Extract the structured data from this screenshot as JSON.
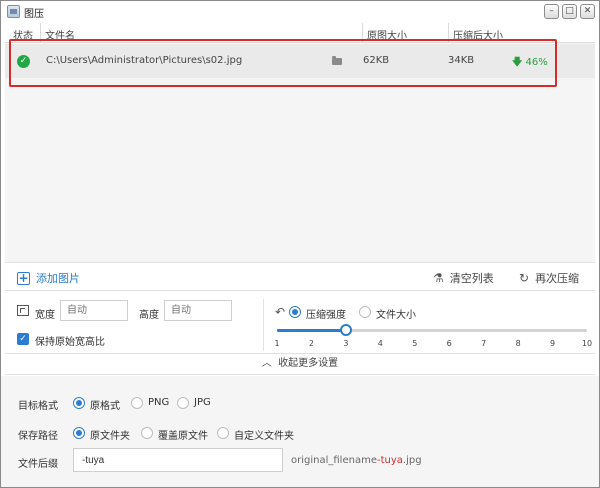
{
  "window": {
    "title": "图压",
    "min_icon": "minimize-icon",
    "max_icon": "maximize-icon",
    "close_icon": "close-icon"
  },
  "table": {
    "headers": [
      "状态",
      "文件名",
      "原图大小",
      "压缩后大小"
    ],
    "rows": [
      {
        "status": "success",
        "filename": "C:\\Users\\Administrator\\Pictures\\s02.jpg",
        "original_size": "62KB",
        "compressed_size": "34KB",
        "reduction": "46%"
      }
    ]
  },
  "toolbar": {
    "add_label": "添加图片",
    "clear_label": "清空列表",
    "recompress_label": "再次压缩"
  },
  "size_settings": {
    "width_label": "宽度",
    "width_placeholder": "自动",
    "height_label": "高度",
    "height_placeholder": "自动",
    "keep_ratio_label": "保持原始宽高比",
    "keep_ratio_checked": true
  },
  "compress_mode": {
    "options": [
      "压缩强度",
      "文件大小"
    ],
    "selected": "压缩强度",
    "slider": {
      "min": 1,
      "max": 10,
      "value": 3,
      "ticks": [
        "1",
        "2",
        "3",
        "4",
        "5",
        "6",
        "7",
        "8",
        "9",
        "10"
      ]
    }
  },
  "collapse_label": "收起更多设置",
  "format": {
    "label": "目标格式",
    "options": [
      "原格式",
      "PNG",
      "JPG"
    ],
    "selected": "原格式"
  },
  "save_path": {
    "label": "保存路径",
    "options": [
      "原文件夹",
      "覆盖原文件",
      "自定义文件夹"
    ],
    "selected": "原文件夹"
  },
  "suffix": {
    "label": "文件后缀",
    "value": "-tuya",
    "example_prefix": "original_filename",
    "example_suffix": "-tuya",
    "example_ext": ".jpg"
  },
  "colors": {
    "accent": "#2b7cd3",
    "success": "#22a745",
    "highlight": "#d52b2b"
  }
}
